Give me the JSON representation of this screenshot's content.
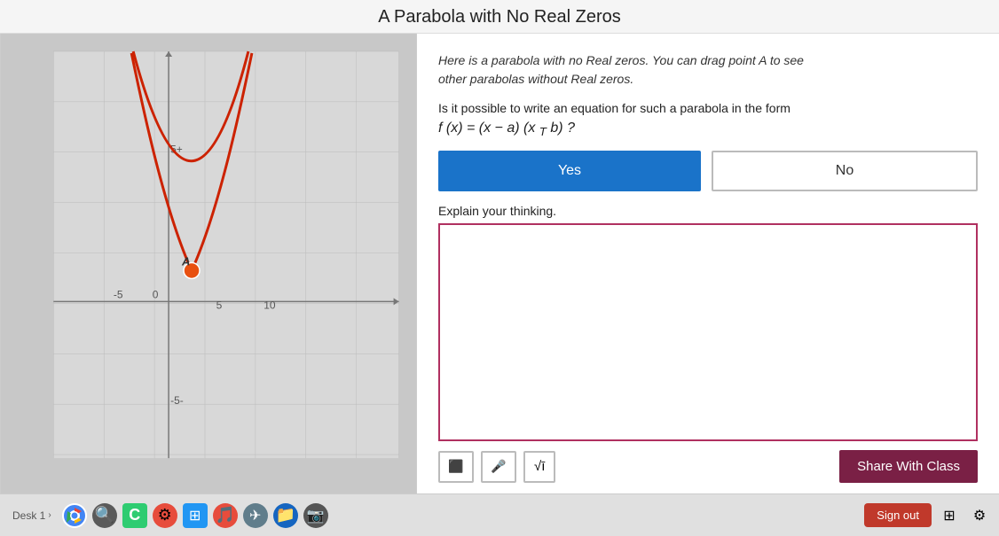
{
  "title": "A Parabola with No Real Zeros",
  "description": {
    "line1_italic": "Here is a parabola with no Real zeros. You can drag point A to see",
    "line2_italic": "other parabolas without Real zeros."
  },
  "question": {
    "prefix": "Is it possible to write an equation for such a parabola in the form",
    "equation": "f (x) = (x − a) (x ",
    "equation_sub": "T",
    "equation_suffix": " b) ?"
  },
  "buttons": {
    "yes": "Yes",
    "no": "No"
  },
  "explain_label": "Explain your thinking.",
  "toolbar": {
    "image_icon": "🖼",
    "mic_icon": "🎤",
    "sqrt_label": "√ī"
  },
  "share_button": "Share With Class",
  "taskbar": {
    "desk_label": "Desk 1",
    "sign_out": "Sign out"
  },
  "graph": {
    "x_min": -5,
    "x_max": 10,
    "y_min": -5,
    "y_max": 8,
    "point_label": "A",
    "axis_labels": {
      "x_negative": "-5",
      "x_zero": "0",
      "x_five": "5",
      "x_ten": "10",
      "y_five": "5+",
      "y_neg_five": "-5-"
    }
  },
  "colors": {
    "yes_button": "#1a73c9",
    "no_button_border": "#bbbbbb",
    "text_area_border": "#9b2557",
    "share_button": "#7a2045",
    "parabola_stroke": "#cc2200",
    "point_fill": "#e85010"
  }
}
